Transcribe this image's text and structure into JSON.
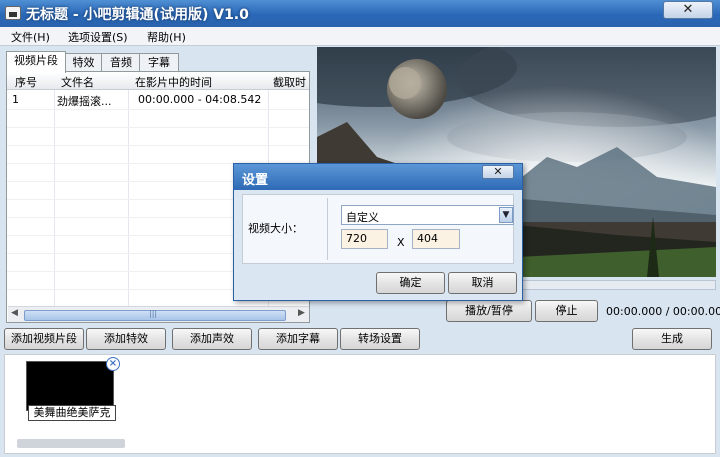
{
  "window": {
    "title": "无标题 - 小吧剪辑通(试用版) V1.0",
    "close_symbol": "✕",
    "app_icon": "film-app-icon"
  },
  "menu": [
    {
      "label": "文件(H)"
    },
    {
      "label": "选项设置(S)"
    },
    {
      "label": "帮助(H)"
    }
  ],
  "tabs": [
    {
      "label": "视频片段",
      "active": true
    },
    {
      "label": "特效"
    },
    {
      "label": "音频"
    },
    {
      "label": "字幕"
    }
  ],
  "list": {
    "headers": [
      "序号",
      "文件名",
      "在影片中的时间",
      "截取时"
    ],
    "rows": [
      {
        "index": "1",
        "name": "劲爆摇滚...",
        "time": "00:00.000 - 04:08.542"
      }
    ],
    "scroll_left": "◀",
    "scroll_right": "▶",
    "thumb_grip": "|||"
  },
  "player": {
    "play_pause": "播放/暂停",
    "stop": "停止",
    "time": "00:00.000 / 00:00.000",
    "progress": 0
  },
  "toolbar": {
    "add_clip": "添加视频片段",
    "add_effect": "添加特效",
    "add_sound": "添加声效",
    "add_subtitle": "添加字幕",
    "transition": "转场设置",
    "generate": "生成"
  },
  "timeline": {
    "clip_label": "美舞曲绝美萨克",
    "clip_close": "×"
  },
  "dialog": {
    "title": "设置",
    "close_symbol": "✕",
    "size_label": "视频大小：",
    "size_option": "自定义",
    "width": "720",
    "x": "X",
    "height": "404",
    "ok": "确定",
    "cancel": "取消"
  },
  "colors": {
    "title_bar": "#2a68b8",
    "window_bg": "#d9e4f1",
    "dialog_bg": "#dbe6f3"
  }
}
